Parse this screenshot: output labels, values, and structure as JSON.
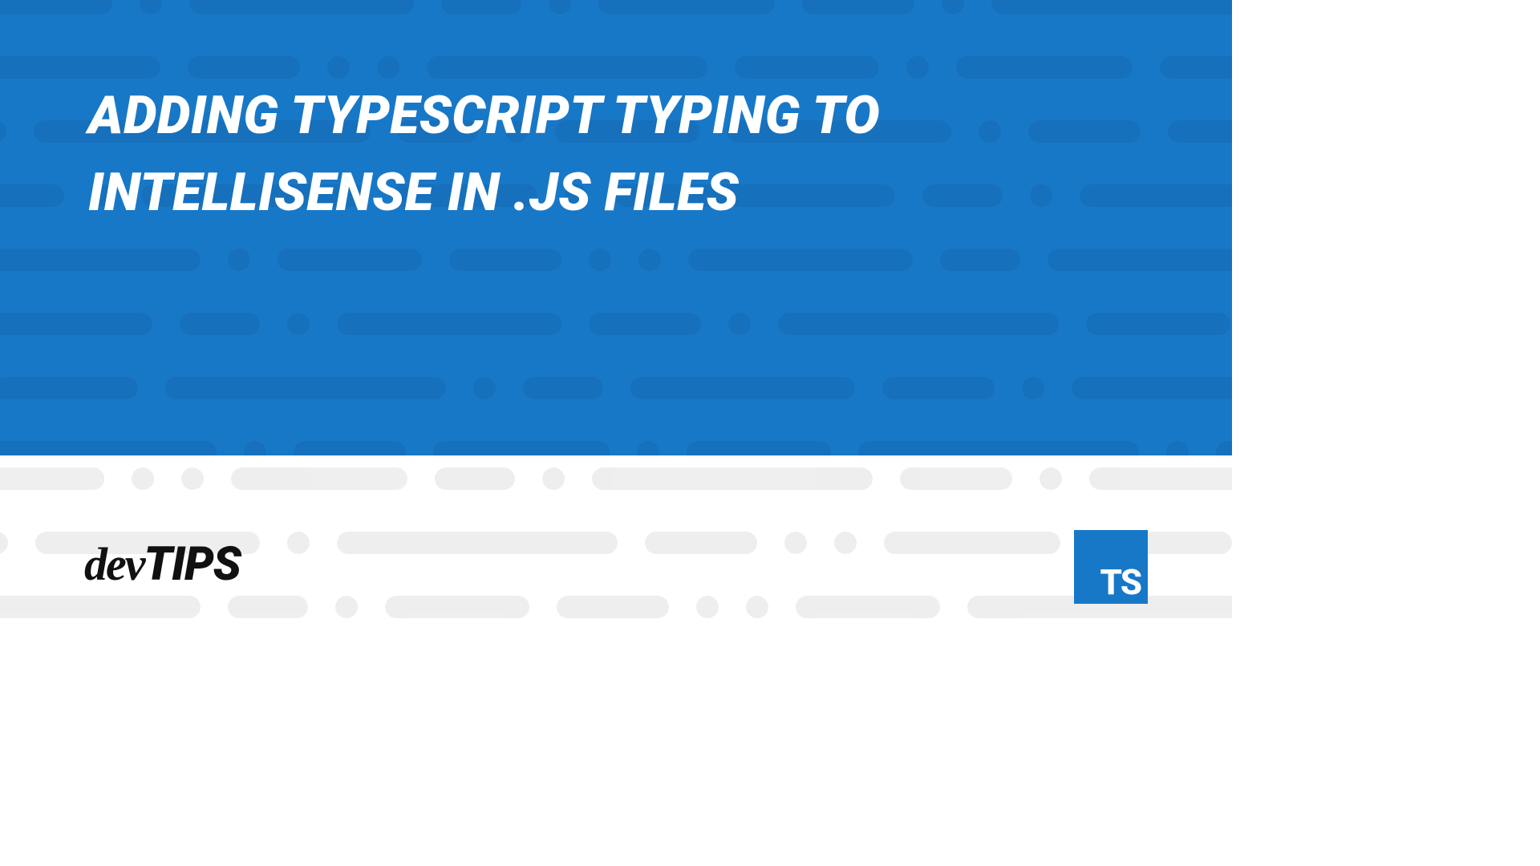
{
  "title": "ADDING TYPESCRIPT TYPING TO INTELLISENSE IN .JS FILES",
  "brand_prefix": "dev",
  "brand_suffix": "TIPS",
  "ts_logo_text": "TS",
  "colors": {
    "primary": "#1878c8",
    "pattern_dark": "#0b3c6b",
    "pattern_light": "#e8e8e8",
    "text_light": "#ffffff",
    "text_dark": "#111111"
  }
}
